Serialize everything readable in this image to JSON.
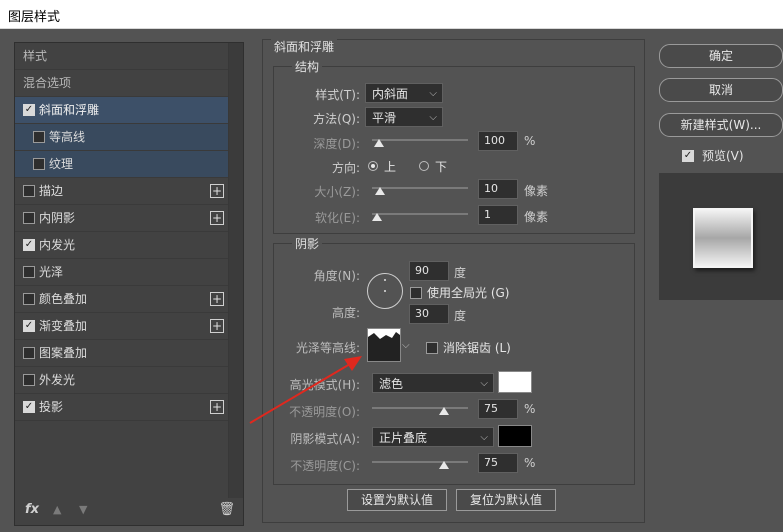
{
  "window": {
    "title": "图层样式"
  },
  "left_panel": {
    "items": [
      {
        "label": "样式",
        "type": "header"
      },
      {
        "label": "混合选项",
        "type": "header"
      },
      {
        "label": "斜面和浮雕",
        "checked": true,
        "selected": true
      },
      {
        "label": "等高线",
        "checked": false,
        "sub": true
      },
      {
        "label": "纹理",
        "checked": false,
        "sub": true
      },
      {
        "label": "描边",
        "checked": false,
        "plus": true
      },
      {
        "label": "内阴影",
        "checked": false,
        "plus": true
      },
      {
        "label": "内发光",
        "checked": true
      },
      {
        "label": "光泽",
        "checked": false
      },
      {
        "label": "颜色叠加",
        "checked": false,
        "plus": true
      },
      {
        "label": "渐变叠加",
        "checked": true,
        "plus": true
      },
      {
        "label": "图案叠加",
        "checked": false
      },
      {
        "label": "外发光",
        "checked": false
      },
      {
        "label": "投影",
        "checked": true,
        "plus": true
      }
    ],
    "fx_label": "fx"
  },
  "bevel": {
    "title": "斜面和浮雕",
    "structure_title": "结构",
    "style_label": "样式(T):",
    "style_value": "内斜面",
    "technique_label": "方法(Q):",
    "technique_value": "平滑",
    "depth_label": "深度(D):",
    "depth_value": "100",
    "depth_unit": "%",
    "direction_label": "方向:",
    "dir_up": "上",
    "dir_down": "下",
    "size_label": "大小(Z):",
    "size_value": "10",
    "size_unit": "像素",
    "soften_label": "软化(E):",
    "soften_value": "1",
    "soften_unit": "像素"
  },
  "shading": {
    "title": "阴影",
    "angle_label": "角度(N):",
    "angle_value": "90",
    "angle_unit": "度",
    "global_light_label": "使用全局光 (G)",
    "altitude_label": "高度:",
    "altitude_value": "30",
    "altitude_unit": "度",
    "gloss_label": "光泽等高线:",
    "antialias_label": "消除锯齿 (L)",
    "highlight_mode_label": "高光模式(H):",
    "highlight_mode_value": "滤色",
    "highlight_color": "#ffffff",
    "highlight_opacity_label": "不透明度(O):",
    "highlight_opacity_value": "75",
    "highlight_opacity_unit": "%",
    "shadow_mode_label": "阴影模式(A):",
    "shadow_mode_value": "正片叠底",
    "shadow_color": "#000000",
    "shadow_opacity_label": "不透明度(C):",
    "shadow_opacity_value": "75",
    "shadow_opacity_unit": "%"
  },
  "buttons": {
    "set_default": "设置为默认值",
    "reset_default": "复位为默认值",
    "ok": "确定",
    "cancel": "取消",
    "new_style": "新建样式(W)...",
    "preview": "预览(V)"
  },
  "colors": {
    "accent_selected": "#3d5068",
    "annotation_arrow": "#e0281e"
  }
}
